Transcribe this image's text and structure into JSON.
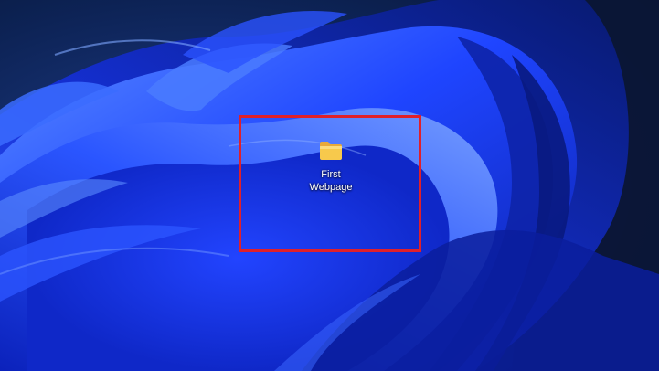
{
  "desktop": {
    "wallpaper": "windows-11-bloom",
    "colors": {
      "background_dark": "#0a1a3a",
      "bloom_blue": "#1a3cff",
      "bloom_light": "#4a7bff",
      "highlight_red": "#e0202a",
      "folder_yellow": "#f5c64a"
    },
    "icons": [
      {
        "icon_name": "folder-icon",
        "label": "First\nWebpage"
      }
    ]
  }
}
